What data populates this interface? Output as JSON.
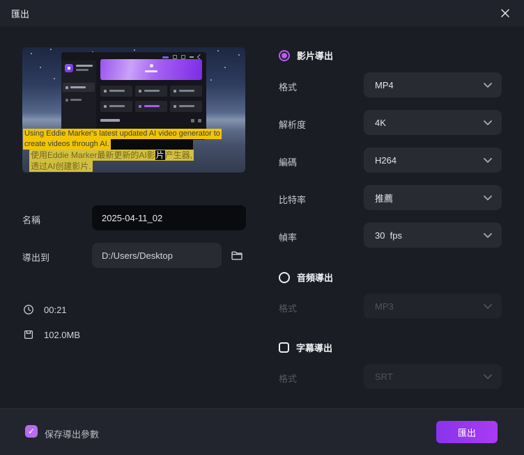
{
  "window": {
    "title": "匯出"
  },
  "icons": {
    "check": "✓"
  },
  "colors": {
    "accent": "#bb5cf2",
    "button_gradient_start": "#8a33ec",
    "button_gradient_end": "#aa3bf4",
    "subtitle_highlight": "#f2c504",
    "checkbox_checked": "#b86cf0"
  },
  "preview": {
    "subtitles": {
      "en": [
        "Using Eddie Marker's latest updated AI video generator to",
        "create videos through AI."
      ],
      "zh_pre": "使用Eddie Marker最新更新的AI影",
      "zh_highlight": "片",
      "zh_post": "产生器,",
      "zh_line2": "透过AI创建影片."
    }
  },
  "left_form": {
    "name_label": "名稱",
    "name_value": "2025-04-11_02",
    "dest_label": "導出到",
    "dest_value": "D:/Users/Desktop"
  },
  "meta": {
    "duration": "00:21",
    "filesize": "102.0MB"
  },
  "video_section": {
    "title": "影片導出",
    "rows": [
      {
        "label": "格式",
        "value": "MP4"
      },
      {
        "label": "解析度",
        "value": "4K"
      },
      {
        "label": "編碼",
        "value": "H264"
      },
      {
        "label": "比特率",
        "value": "推薦"
      },
      {
        "label": "幀率",
        "value": "30  fps"
      }
    ]
  },
  "audio_section": {
    "title": "音頻導出",
    "format_label": "格式",
    "format_value": "MP3"
  },
  "subtitle_section": {
    "title": "字幕導出",
    "format_label": "格式",
    "format_value": "SRT"
  },
  "footer": {
    "save_label": "保存導出參數",
    "export_label": "匯出"
  }
}
